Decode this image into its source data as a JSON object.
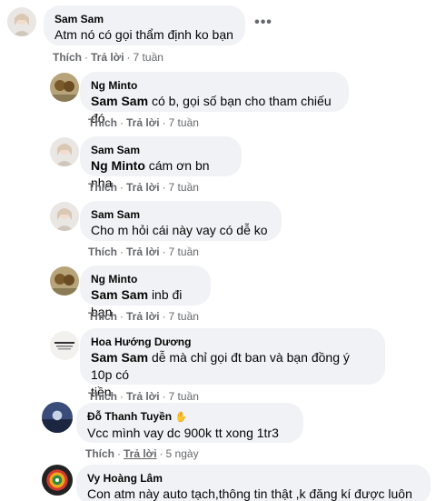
{
  "comments": [
    {
      "author": "Sam Sam",
      "mention": "",
      "text": "Atm nó có gọi thẩm định ko bạn",
      "like": "Thích",
      "reply": "Trả lời",
      "time": "7 tuần",
      "more": "•••"
    },
    {
      "author": "Ng Minto",
      "mention": "Sam Sam",
      "text": "có b, gọi số bạn cho tham chiếu đó",
      "like": "Thích",
      "reply": "Trả lời",
      "time": "7 tuần"
    },
    {
      "author": "Sam Sam",
      "mention": "Ng Minto",
      "text": "cám ơn bn nha",
      "like": "Thích",
      "reply": "Trả lời",
      "time": "7 tuần"
    },
    {
      "author": "Sam Sam",
      "mention": "",
      "text": "Cho m hỏi cái này vay có dễ ko",
      "like": "Thích",
      "reply": "Trả lời",
      "time": "7 tuần"
    },
    {
      "author": "Ng Minto",
      "mention": "Sam Sam",
      "text": "inb đi bạn",
      "like": "Thích",
      "reply": "Trả lời",
      "time": "7 tuần"
    },
    {
      "author": "Hoa Hướng Dương",
      "mention": "Sam Sam",
      "text_line1": "dễ mà chỉ gọi đt ban và bạn đồng ý 10p có",
      "text_line2": "tiền",
      "like": "Thích",
      "reply": "Trả lời",
      "time": "7 tuần"
    },
    {
      "author": "Đỗ Thanh Tuyền",
      "mention": "",
      "text": "Vcc mình vay dc 900k tt xong 1tr3",
      "like": "Thích",
      "reply": "Trả lời",
      "time": "5 ngày"
    },
    {
      "author": "Vy Hoàng Lâm",
      "mention": "",
      "text": "Con atm này auto tạch,thông tin thật ,k đăng kí được luôn"
    }
  ],
  "icons": [
    "avatar-sam-sam",
    "avatar-ng-minto",
    "avatar-hoa-huong-duong",
    "avatar-do-thanh-tuyen",
    "avatar-vy-hoang-lam",
    "waving-hand-icon",
    "thinking-face-icon",
    "more-options-icon"
  ]
}
